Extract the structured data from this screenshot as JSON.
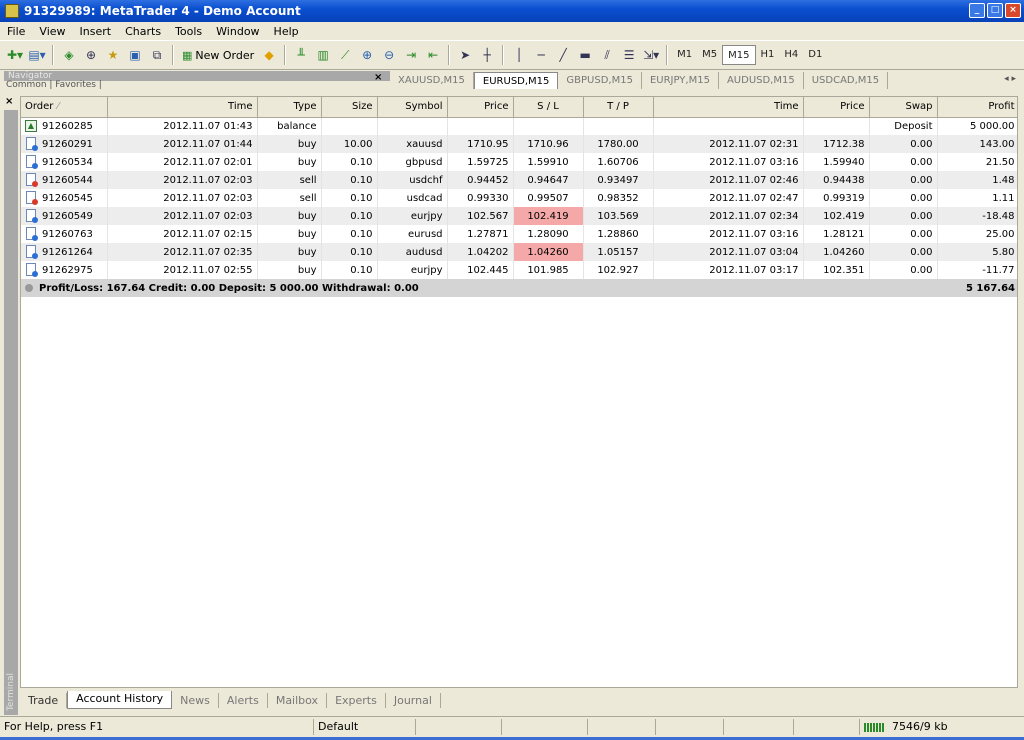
{
  "window": {
    "title": "91329989: MetaTrader 4 - Demo Account"
  },
  "menu": [
    "File",
    "View",
    "Insert",
    "Charts",
    "Tools",
    "Window",
    "Help"
  ],
  "toolbar": {
    "new_order_label": "New Order",
    "timeframes": [
      "M1",
      "M5",
      "M15",
      "H1",
      "H4",
      "D1"
    ],
    "active_timeframe": "M15"
  },
  "navigator": {
    "title": "Navigator",
    "subtabs": "Common | Favorites |"
  },
  "chart_tabs": {
    "items": [
      "XAUUSD,M15",
      "EURUSD,M15",
      "GBPUSD,M15",
      "EURJPY,M15",
      "AUDUSD,M15",
      "USDCAD,M15"
    ],
    "active": "EURUSD,M15"
  },
  "terminal": {
    "side_label": "Terminal",
    "columns": [
      "Order",
      "Time",
      "Type",
      "Size",
      "Symbol",
      "Price",
      "S / L",
      "T / P",
      "Time",
      "Price",
      "Swap",
      "Profit"
    ],
    "rows": [
      [
        "91260285",
        "2012.11.07 01:43",
        "balance",
        "",
        "",
        "",
        "",
        "",
        "",
        "",
        "Deposit",
        "5 000.00"
      ],
      [
        "91260291",
        "2012.11.07 01:44",
        "buy",
        "10.00",
        "xauusd",
        "1710.95",
        "1710.96",
        "1780.00",
        "2012.11.07 02:31",
        "1712.38",
        "0.00",
        "143.00"
      ],
      [
        "91260534",
        "2012.11.07 02:01",
        "buy",
        "0.10",
        "gbpusd",
        "1.59725",
        "1.59910",
        "1.60706",
        "2012.11.07 03:16",
        "1.59940",
        "0.00",
        "21.50"
      ],
      [
        "91260544",
        "2012.11.07 02:03",
        "sell",
        "0.10",
        "usdchf",
        "0.94452",
        "0.94647",
        "0.93497",
        "2012.11.07 02:46",
        "0.94438",
        "0.00",
        "1.48"
      ],
      [
        "91260545",
        "2012.11.07 02:03",
        "sell",
        "0.10",
        "usdcad",
        "0.99330",
        "0.99507",
        "0.98352",
        "2012.11.07 02:47",
        "0.99319",
        "0.00",
        "1.11"
      ],
      [
        "91260549",
        "2012.11.07 02:03",
        "buy",
        "0.10",
        "eurjpy",
        "102.567",
        "102.419",
        "103.569",
        "2012.11.07 02:34",
        "102.419",
        "0.00",
        "-18.48"
      ],
      [
        "91260763",
        "2012.11.07 02:15",
        "buy",
        "0.10",
        "eurusd",
        "1.27871",
        "1.28090",
        "1.28860",
        "2012.11.07 03:16",
        "1.28121",
        "0.00",
        "25.00"
      ],
      [
        "91261264",
        "2012.11.07 02:35",
        "buy",
        "0.10",
        "audusd",
        "1.04202",
        "1.04260",
        "1.05157",
        "2012.11.07 03:04",
        "1.04260",
        "0.00",
        "5.80"
      ],
      [
        "91262975",
        "2012.11.07 02:55",
        "buy",
        "0.10",
        "eurjpy",
        "102.445",
        "101.985",
        "102.927",
        "2012.11.07 03:17",
        "102.351",
        "0.00",
        "-11.77"
      ]
    ],
    "row_icons": [
      "balance",
      "blue",
      "blue",
      "red",
      "red",
      "blue",
      "blue",
      "blue",
      "blue"
    ],
    "hit_cells": [
      [
        5,
        6
      ],
      [
        7,
        6
      ]
    ],
    "summary": {
      "text": "Profit/Loss: 167.64  Credit: 0.00  Deposit: 5 000.00  Withdrawal: 0.00",
      "total": "5 167.64"
    },
    "bottom_tabs": [
      "Trade",
      "Account History",
      "News",
      "Alerts",
      "Mailbox",
      "Experts",
      "Journal"
    ],
    "active_bottom_tab": "Account History"
  },
  "statusbar": {
    "help": "For Help, press F1",
    "profile": "Default",
    "traffic": "7546/9 kb"
  },
  "colors": {
    "titlebar": "#0a4fd0",
    "sl_hit": "#f4a8a8",
    "summary_row": "#d4d4d4"
  }
}
